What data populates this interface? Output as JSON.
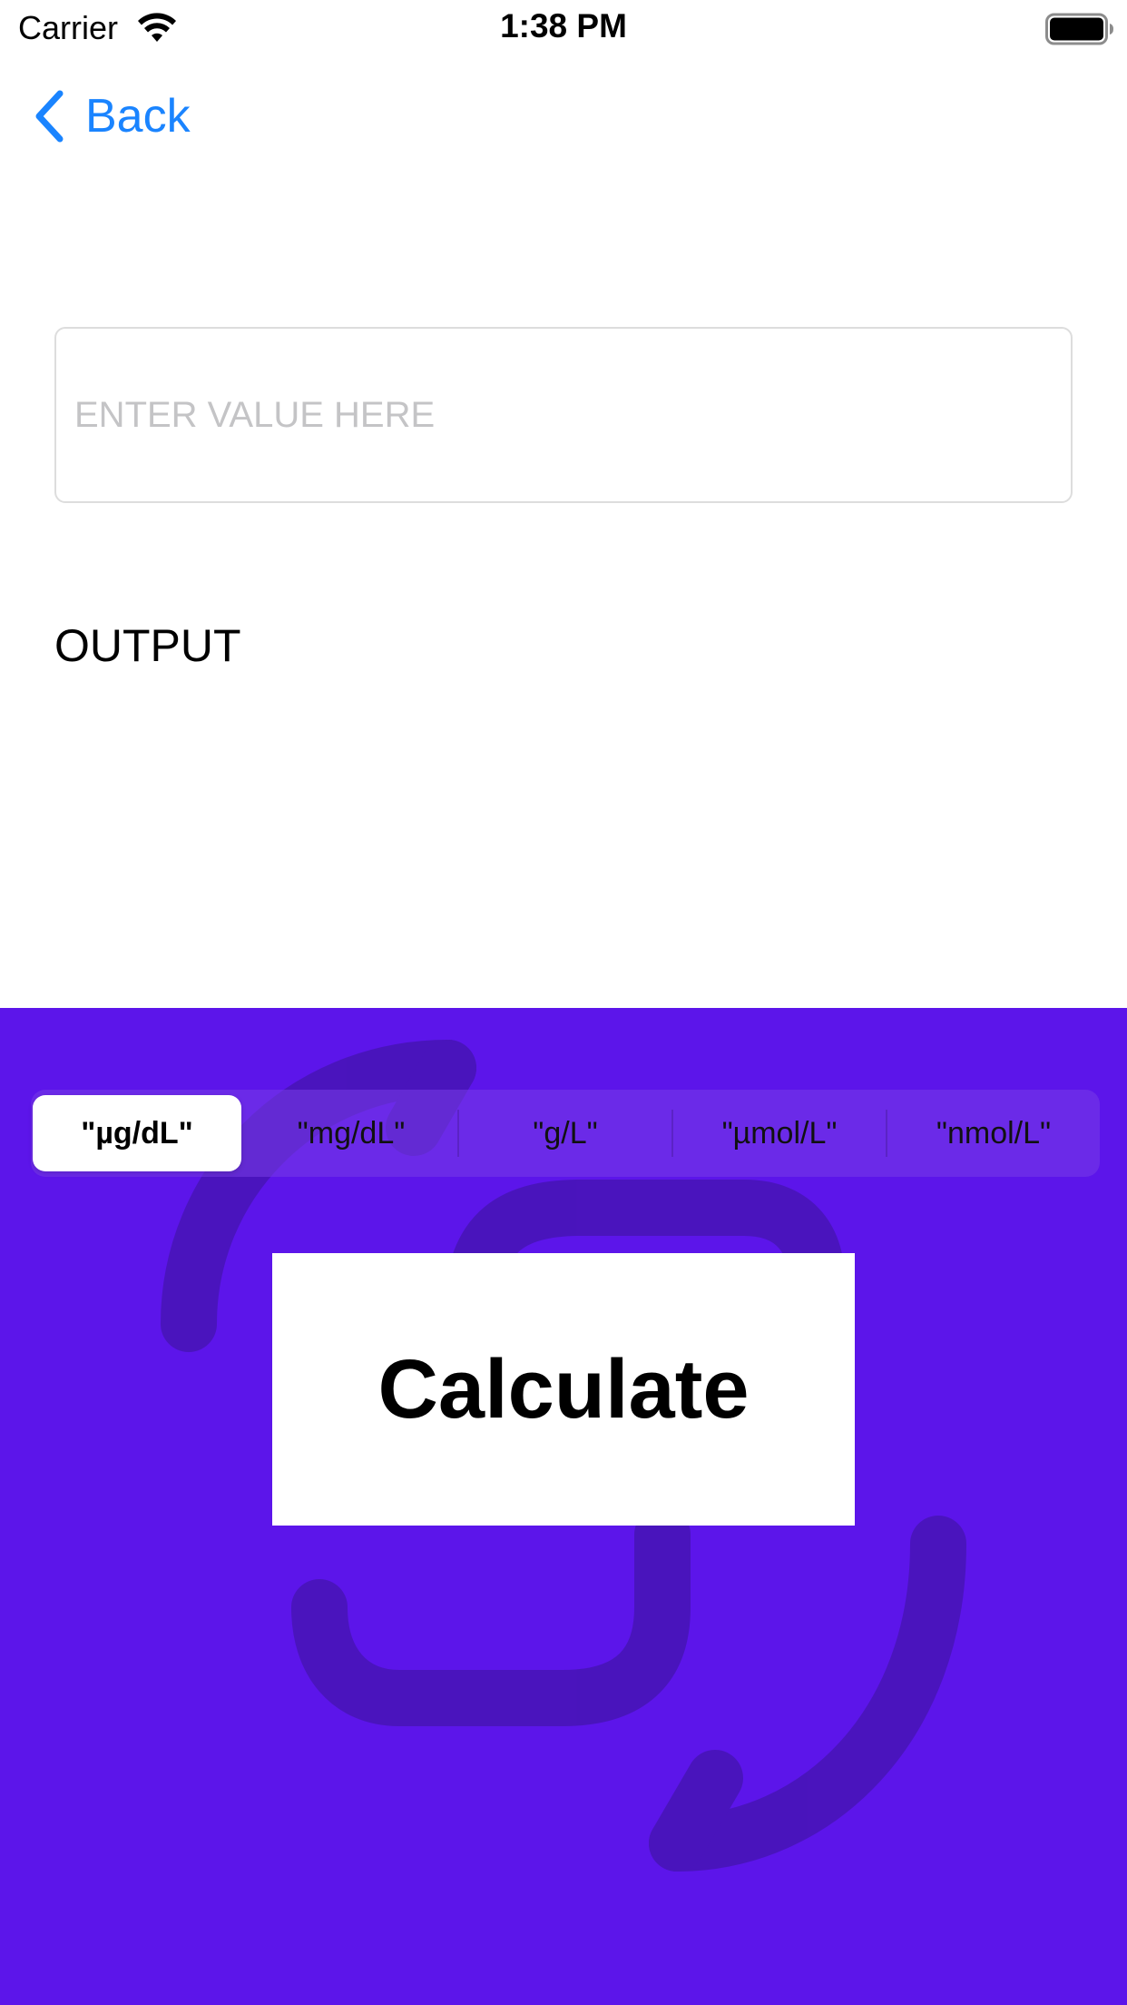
{
  "status_bar": {
    "carrier": "Carrier",
    "time": "1:38 PM",
    "wifi_icon": "wifi-icon",
    "battery_icon": "battery-icon"
  },
  "nav": {
    "back_label": "Back",
    "back_icon": "chevron-left-icon"
  },
  "input": {
    "placeholder": "ENTER VALUE HERE",
    "value": ""
  },
  "output": {
    "label": "OUTPUT"
  },
  "unit_selector": {
    "selected_index": 0,
    "options": [
      "\"µg/dL\"",
      "\"mg/dL\"",
      "\"g/L\"",
      "\"µmol/L\"",
      "\"nmol/L\""
    ]
  },
  "calculate_button": {
    "label": "Calculate"
  },
  "colors": {
    "accent_blue": "#1a84ff",
    "panel_purple": "#5c15ea",
    "watermark_purple": "#4814b8"
  },
  "background_icon": "convert-arrows-icon"
}
